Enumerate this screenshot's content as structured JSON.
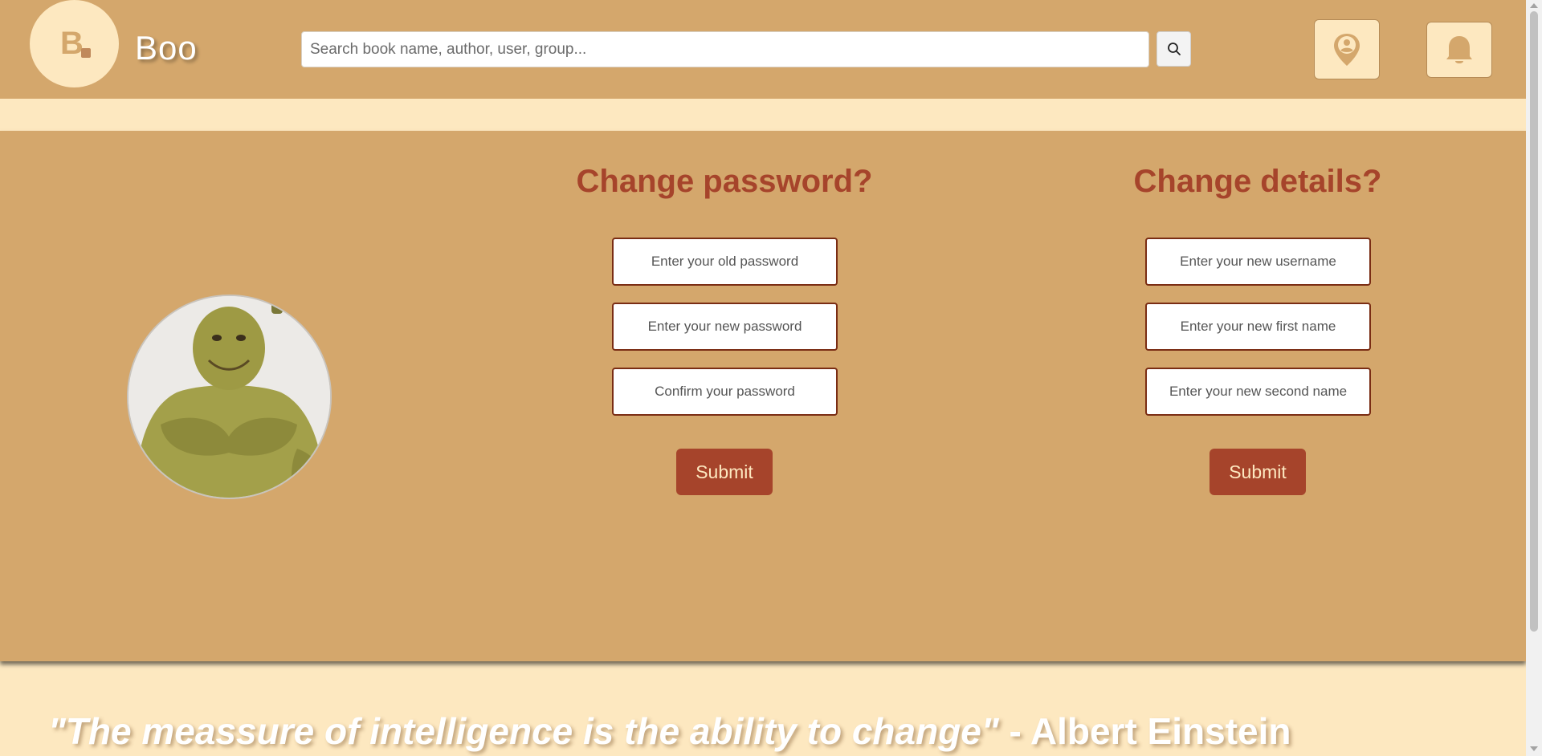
{
  "header": {
    "logo_letter": "B",
    "brand": "Boo",
    "search": {
      "placeholder": "Search book name, author, user, group...",
      "value": ""
    },
    "icons": {
      "search": "search-icon",
      "location": "location-pin-user-icon",
      "notifications": "bell-icon"
    }
  },
  "profile": {
    "avatar": "user-avatar"
  },
  "password_form": {
    "title": "Change password?",
    "old_password_placeholder": "Enter your old password",
    "new_password_placeholder": "Enter your new password",
    "confirm_password_placeholder": "Confirm your password",
    "submit_label": "Submit"
  },
  "details_form": {
    "title": "Change details?",
    "username_placeholder": "Enter your new username",
    "first_name_placeholder": "Enter your new first name",
    "second_name_placeholder": "Enter your new second name",
    "submit_label": "Submit"
  },
  "quote": {
    "text": "\"The meassure of intelligence is the ability to change\"",
    "author": " - Albert Einstein"
  },
  "colors": {
    "primary": "#d4a76c",
    "cream": "#fde8c0",
    "accent": "#a6442b",
    "field_border": "#7a2d14"
  }
}
